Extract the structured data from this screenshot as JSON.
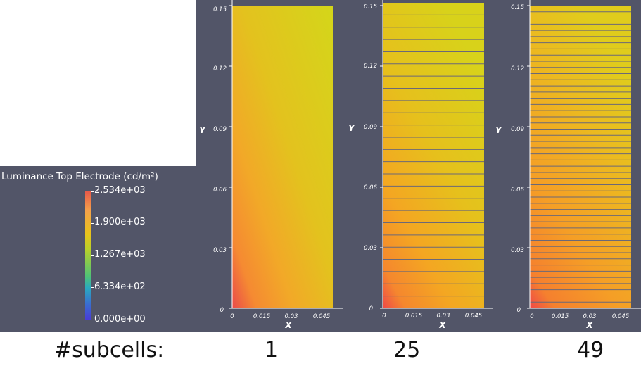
{
  "legend": {
    "title": "Luminance Top Electrode (cd/m²)",
    "labels": [
      "2.534e+03",
      "1.900e+03",
      "1.267e+03",
      "6.334e+02",
      "0.000e+00"
    ]
  },
  "axes": {
    "x_label": "X",
    "y_label": "Y",
    "x_ticks": [
      "0",
      "0.015",
      "0.03",
      "0.045"
    ],
    "y_ticks": [
      "0.15",
      "0.12",
      "0.09",
      "0.06",
      "0.03",
      "0"
    ]
  },
  "footer": {
    "label": "#subcells:",
    "values": [
      "1",
      "25",
      "49"
    ]
  },
  "chart_data": [
    {
      "type": "heatmap",
      "subcells": 1,
      "xlabel": "X",
      "ylabel": "Y",
      "xlim": [
        0,
        0.047
      ],
      "ylim": [
        0,
        0.15
      ],
      "colorbar_range": [
        0,
        2534
      ],
      "colorbar_title": "Luminance Top Electrode (cd/m²)"
    },
    {
      "type": "heatmap",
      "subcells": 25,
      "xlabel": "X",
      "ylabel": "Y",
      "xlim": [
        0,
        0.047
      ],
      "ylim": [
        0,
        0.15
      ],
      "colorbar_range": [
        0,
        2534
      ],
      "colorbar_title": "Luminance Top Electrode (cd/m²)"
    },
    {
      "type": "heatmap",
      "subcells": 49,
      "xlabel": "X",
      "ylabel": "Y",
      "xlim": [
        0,
        0.047
      ],
      "ylim": [
        0,
        0.15
      ],
      "colorbar_range": [
        0,
        2534
      ],
      "colorbar_title": "Luminance Top Electrode (cd/m²)"
    }
  ],
  "colors": {
    "background": "#525568",
    "high": "#e8444a",
    "mid_orange": "#f5a020",
    "mid_yellow": "#dcd21a",
    "grid_line": "#6b6878"
  }
}
